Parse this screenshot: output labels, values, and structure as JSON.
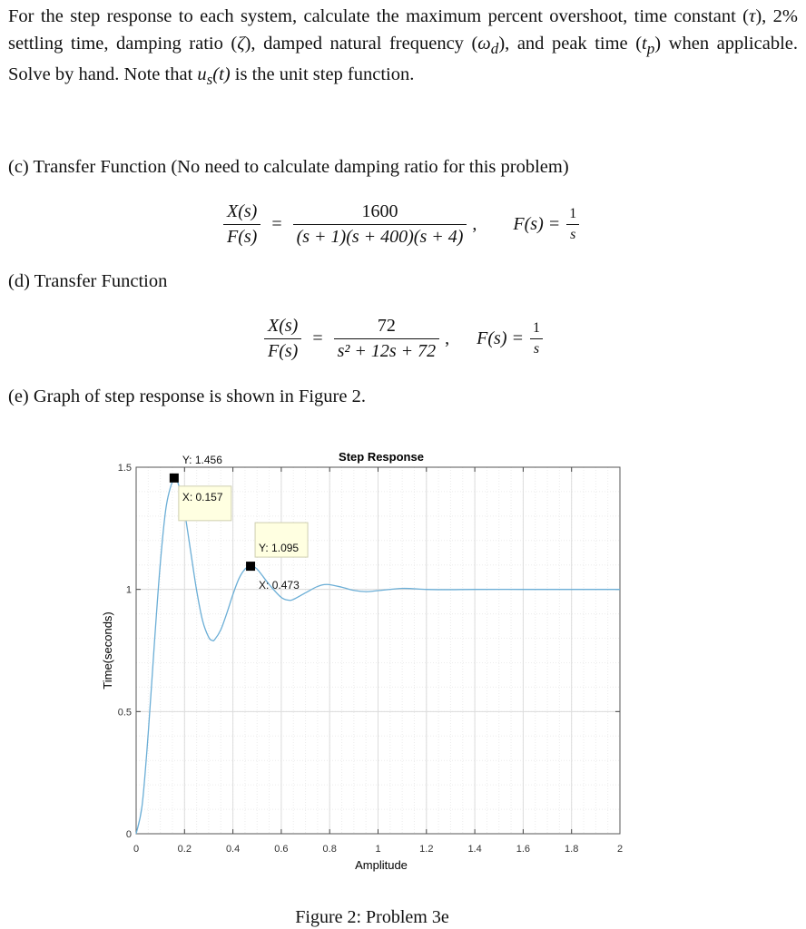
{
  "intro": {
    "s1": "For the step response to each system, calculate the maximum percent overshoot, time constant (",
    "tau": "τ",
    "s2": "), 2% settling time, damping ratio (",
    "zeta": "ζ",
    "s3": "), damped natural frequency (",
    "omega_d": "ω",
    "omega_sub": "d",
    "s4": "), and peak time (",
    "tp": "t",
    "tp_sub": "p",
    "s5": ") when applicable. Solve by hand. Note that ",
    "us": "u",
    "us_sub": "s",
    "us_arg": "(t)",
    "s6": " is the unit step function."
  },
  "problems": {
    "c": {
      "label": "(c) Transfer Function (No need to calculate damping ratio for this problem)",
      "lhs_num": "X(s)",
      "lhs_den": "F(s)",
      "eq": "=",
      "rhs_num": "1600",
      "rhs_den": "(s + 1)(s + 400)(s + 4)",
      "comma": ",",
      "input_lhs": "F(s) =",
      "input_num": "1",
      "input_den": "s"
    },
    "d": {
      "label": "(d) Transfer Function",
      "lhs_num": "X(s)",
      "lhs_den": "F(s)",
      "eq": "=",
      "rhs_num": "72",
      "rhs_den": "s² + 12s + 72",
      "comma": ",",
      "input_lhs": "F(s) =",
      "input_num": "1",
      "input_den": "s"
    },
    "e": {
      "label": "(e) Graph of step response is shown in Figure 2."
    }
  },
  "chart_data": {
    "type": "line",
    "title": "Step Response",
    "xlabel": "Amplitude",
    "ylabel": "Time(seconds)",
    "xlim": [
      0,
      2
    ],
    "ylim": [
      0,
      1.5
    ],
    "xticks": [
      "0",
      "0.2",
      "0.4",
      "0.6",
      "0.8",
      "1",
      "1.2",
      "1.4",
      "1.6",
      "1.8",
      "2"
    ],
    "yticks": [
      "0",
      "0.5",
      "1",
      "1.5"
    ],
    "grid": true,
    "minor_grid": true,
    "line_color": "#6baed6",
    "x": [
      0,
      0.025,
      0.05,
      0.075,
      0.1,
      0.125,
      0.157,
      0.175,
      0.2,
      0.225,
      0.25,
      0.275,
      0.3,
      0.315,
      0.325,
      0.35,
      0.375,
      0.4,
      0.425,
      0.45,
      0.473,
      0.5,
      0.55,
      0.6,
      0.63,
      0.65,
      0.7,
      0.75,
      0.79,
      0.85,
      0.9,
      0.95,
      1.0,
      1.1,
      1.2,
      1.3,
      1.4,
      1.6,
      1.8,
      2.0
    ],
    "y": [
      0,
      0.119,
      0.412,
      0.773,
      1.108,
      1.344,
      1.456,
      1.429,
      1.318,
      1.158,
      0.996,
      0.871,
      0.804,
      0.791,
      0.795,
      0.835,
      0.903,
      0.979,
      1.044,
      1.083,
      1.095,
      1.083,
      1.02,
      0.967,
      0.956,
      0.959,
      0.986,
      1.012,
      1.02,
      1.009,
      0.996,
      0.991,
      0.995,
      1.004,
      1.0,
      0.999,
      1.0,
      1.0,
      1.0,
      1.0
    ],
    "datatips": [
      {
        "x": 0.157,
        "y": 1.456,
        "line1": "X: 0.157",
        "line2": "Y: 1.456"
      },
      {
        "x": 0.473,
        "y": 1.095,
        "line1": "X: 0.473",
        "line2": "Y: 1.095"
      }
    ]
  },
  "caption": "Figure 2: Problem 3e"
}
